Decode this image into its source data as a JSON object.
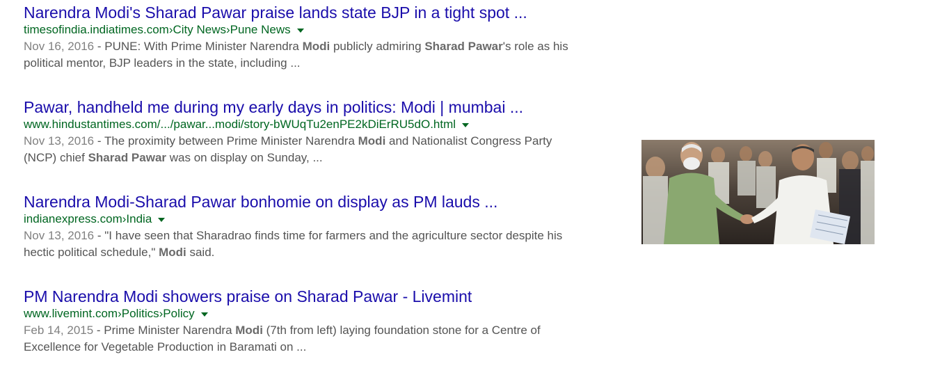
{
  "results": [
    {
      "title": "Narendra Modi's Sharad Pawar praise lands state BJP in a tight spot ...",
      "url_parts": [
        "timesofindia.indiatimes.com",
        "City News",
        "Pune News"
      ],
      "date": "Nov 16, 2016",
      "snippet": [
        {
          "t": " - PUNE: With Prime Minister Narendra ",
          "b": false
        },
        {
          "t": "Modi",
          "b": true
        },
        {
          "t": " publicly admiring ",
          "b": false
        },
        {
          "t": "Sharad Pawar",
          "b": true
        },
        {
          "t": "'s role as his political mentor, BJP leaders in the state, including ...",
          "b": false
        }
      ]
    },
    {
      "title": "Pawar, handheld me during my early days in politics: Modi | mumbai ...",
      "url_parts": [
        "www.hindustantimes.com/.../pawar...modi/story-bWUqTu2enPE2kDiErRU5dO.html"
      ],
      "date": "Nov 13, 2016",
      "snippet": [
        {
          "t": " - The proximity between Prime Minister Narendra ",
          "b": false
        },
        {
          "t": "Modi",
          "b": true
        },
        {
          "t": " and Nationalist Congress Party (NCP) chief ",
          "b": false
        },
        {
          "t": "Sharad Pawar",
          "b": true
        },
        {
          "t": " was on display on Sunday, ...",
          "b": false
        }
      ]
    },
    {
      "title": "Narendra Modi-Sharad Pawar bonhomie on display as PM lauds ...",
      "url_parts": [
        "indianexpress.com",
        "India"
      ],
      "date": "Nov 13, 2016",
      "snippet": [
        {
          "t": " - \"I have seen that Sharadrao finds time for farmers and the agriculture sector despite his hectic political schedule,\" ",
          "b": false
        },
        {
          "t": "Modi",
          "b": true
        },
        {
          "t": " said.",
          "b": false
        }
      ]
    },
    {
      "title": "PM Narendra Modi showers praise on Sharad Pawar - Livemint",
      "url_parts": [
        "www.livemint.com",
        "Politics",
        "Policy"
      ],
      "date": "Feb 14, 2015",
      "snippet": [
        {
          "t": " - Prime Minister Narendra ",
          "b": false
        },
        {
          "t": "Modi",
          "b": true
        },
        {
          "t": " (7th from left) laying foundation stone for a Centre of Excellence for Vegetable Production in Baramati on ...",
          "b": false
        }
      ]
    }
  ],
  "url_separator": " › ",
  "thumbnail": {
    "description": "two men shaking hands"
  }
}
